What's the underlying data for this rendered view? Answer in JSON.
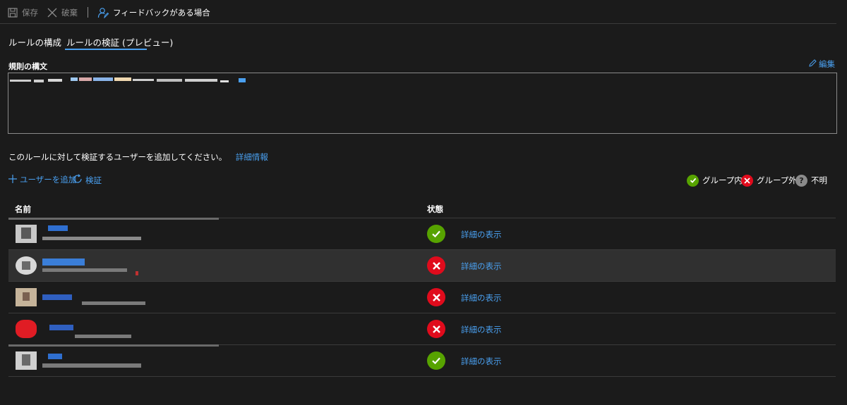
{
  "toolbar": {
    "save_label": "保存",
    "discard_label": "破棄",
    "feedback_label": "フィードバックがある場合"
  },
  "tabs": [
    {
      "label": "ルールの構成",
      "active": false
    },
    {
      "label": "ルールの検証 (プレビュー)",
      "active": true
    }
  ],
  "rule": {
    "label": "規則の構文",
    "edit_label": "編集"
  },
  "intro": {
    "text": "このルールに対して検証するユーザーを追加してください。",
    "link": "詳細情報"
  },
  "actions": {
    "add_user": "ユーザーを追加",
    "validate": "検証"
  },
  "legend": [
    {
      "label": "グループ内",
      "icon": "check-circle-icon",
      "color": "#57a300"
    },
    {
      "label": "グループ外",
      "icon": "x-circle-icon",
      "color": "#e00b1c"
    },
    {
      "label": "不明",
      "icon": "question-circle-icon",
      "color": "#8a8a8a"
    }
  ],
  "table": {
    "columns": [
      "名前",
      "状態"
    ],
    "rows": [
      {
        "status": "in-group",
        "detail": "詳細の表示",
        "selected": false,
        "avatar_color": "#c8c8c8"
      },
      {
        "status": "not-in-group",
        "detail": "詳細の表示",
        "selected": true,
        "avatar_color": "#d8d8d8"
      },
      {
        "status": "not-in-group",
        "detail": "詳細の表示",
        "selected": false,
        "avatar_color": "#c6b49a"
      },
      {
        "status": "not-in-group",
        "detail": "詳細の表示",
        "selected": false,
        "avatar_color": "#e01c24"
      },
      {
        "status": "in-group",
        "detail": "詳細の表示",
        "selected": false,
        "avatar_color": "#d0d0d0"
      }
    ]
  },
  "colors": {
    "accent": "#4aa0f0",
    "in_group": "#57a300",
    "not_in_group": "#e00b1c",
    "unknown": "#8a8a8a",
    "background": "#1b1b1b"
  }
}
